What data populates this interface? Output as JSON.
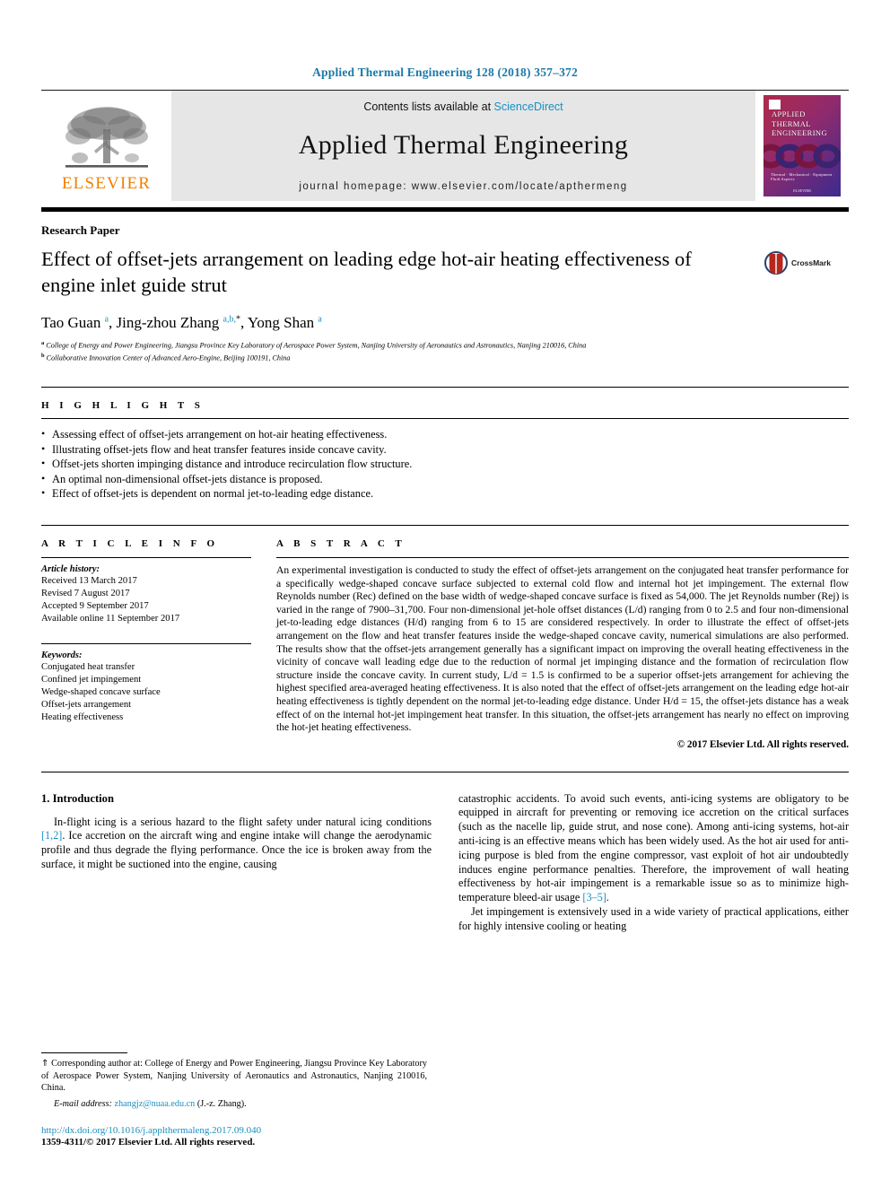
{
  "running_head": "Applied Thermal Engineering 128 (2018) 357–372",
  "masthead": {
    "publisher_logo_text": "ELSEVIER",
    "contents_prefix": "Contents lists available at ",
    "contents_link": "ScienceDirect",
    "journal_title": "Applied Thermal Engineering",
    "homepage": "journal homepage: www.elsevier.com/locate/apthermeng",
    "cover": {
      "line1": "APPLIED",
      "line2": "THERMAL",
      "line3": "ENGINEERING",
      "footer": "Thermal · Mechanical · Equipment · Fluid Aspects",
      "publisher": "ELSEVIER"
    }
  },
  "article": {
    "type": "Research Paper",
    "title": "Effect of offset-jets arrangement on leading edge hot-air heating effectiveness of engine inlet guide strut",
    "crossmark_label": "CrossMark",
    "authors_html": "Tao Guan <sup>a</sup>, Jing-zhou Zhang <sup>a,b,</sup>*, Yong Shan <sup>a</sup>",
    "affiliation_a": "College of Energy and Power Engineering, Jiangsu Province Key Laboratory of Aerospace Power System, Nanjing University of Aeronautics and Astronautics, Nanjing 210016, China",
    "affiliation_b": "Collaborative Innovation Center of Advanced Aero-Engine, Beijing 100191, China"
  },
  "highlights": {
    "label": "H I G H L I G H T S",
    "items": [
      "Assessing effect of offset-jets arrangement on hot-air heating effectiveness.",
      "Illustrating offset-jets flow and heat transfer features inside concave cavity.",
      "Offset-jets shorten impinging distance and introduce recirculation flow structure.",
      "An optimal non-dimensional offset-jets distance is proposed.",
      "Effect of offset-jets is dependent on normal jet-to-leading edge distance."
    ]
  },
  "article_info": {
    "label": "A R T I C L E   I N F O",
    "history_label": "Article history:",
    "history": [
      "Received 13 March 2017",
      "Revised 7 August 2017",
      "Accepted 9 September 2017",
      "Available online 11 September 2017"
    ],
    "keywords_label": "Keywords:",
    "keywords": [
      "Conjugated heat transfer",
      "Confined jet impingement",
      "Wedge-shaped concave surface",
      "Offset-jets arrangement",
      "Heating effectiveness"
    ]
  },
  "abstract": {
    "label": "A B S T R A C T",
    "text": "An experimental investigation is conducted to study the effect of offset-jets arrangement on the conjugated heat transfer performance for a specifically wedge-shaped concave surface subjected to external cold flow and internal hot jet impingement. The external flow Reynolds number (Rec) defined on the base width of wedge-shaped concave surface is fixed as 54,000. The jet Reynolds number (Rej) is varied in the range of 7900–31,700. Four non-dimensional jet-hole offset distances (L/d) ranging from 0 to 2.5 and four non-dimensional jet-to-leading edge distances (H/d) ranging from 6 to 15 are considered respectively. In order to illustrate the effect of offset-jets arrangement on the flow and heat transfer features inside the wedge-shaped concave cavity, numerical simulations are also performed. The results show that the offset-jets arrangement generally has a significant impact on improving the overall heating effectiveness in the vicinity of concave wall leading edge due to the reduction of normal jet impinging distance and the formation of recirculation flow structure inside the concave cavity. In current study, L/d = 1.5 is confirmed to be a superior offset-jets arrangement for achieving the highest specified area-averaged heating effectiveness. It is also noted that the effect of offset-jets arrangement on the leading edge hot-air heating effectiveness is tightly dependent on the normal jet-to-leading edge distance. Under H/d = 15, the offset-jets distance has a weak effect of on the internal hot-jet impingement heat transfer. In this situation, the offset-jets arrangement has nearly no effect on improving the hot-jet heating effectiveness.",
    "copyright": "© 2017 Elsevier Ltd. All rights reserved."
  },
  "body": {
    "section_title": "1. Introduction",
    "left_para_1_a": "In-flight icing is a serious hazard to the flight safety under natural icing conditions ",
    "left_ref_1": "[1,2]",
    "left_para_1_b": ". Ice accretion on the aircraft wing and engine intake will change the aerodynamic profile and thus degrade the flying performance. Once the ice is broken away from the surface, it might be suctioned into the engine, causing",
    "right_para_1": "catastrophic accidents. To avoid such events, anti-icing systems are obligatory to be equipped in aircraft for preventing or removing ice accretion on the critical surfaces (such as the nacelle lip, guide strut, and nose cone). Among anti-icing systems, hot-air anti-icing is an effective means which has been widely used. As the hot air used for anti-icing purpose is bled from the engine compressor, vast exploit of hot air undoubtedly induces engine performance penalties. Therefore, the improvement of wall heating effectiveness by hot-air impingement is a remarkable issue so as to minimize high-temperature bleed-air usage ",
    "right_ref_1": "[3–5]",
    "right_para_1_end": ".",
    "right_para_2": "Jet impingement is extensively used in a wide variety of practical applications, either for highly intensive cooling or heating"
  },
  "footnote": {
    "corresponding": "⇑ Corresponding author at: College of Energy and Power Engineering, Jiangsu Province Key Laboratory of Aerospace Power System, Nanjing University of Aeronautics and Astronautics, Nanjing 210016, China.",
    "email_label": "E-mail address:",
    "email": "zhangjz@nuaa.edu.cn",
    "email_suffix": "(J.-z. Zhang).",
    "doi": "http://dx.doi.org/10.1016/j.applthermaleng.2017.09.040",
    "issn": "1359-4311/© 2017 Elsevier Ltd. All rights reserved."
  },
  "colors": {
    "link": "#1a8fc1",
    "running_head": "#1a7aa8",
    "elsevier_orange": "#f08000",
    "masthead_bg": "#e6e6e6"
  }
}
